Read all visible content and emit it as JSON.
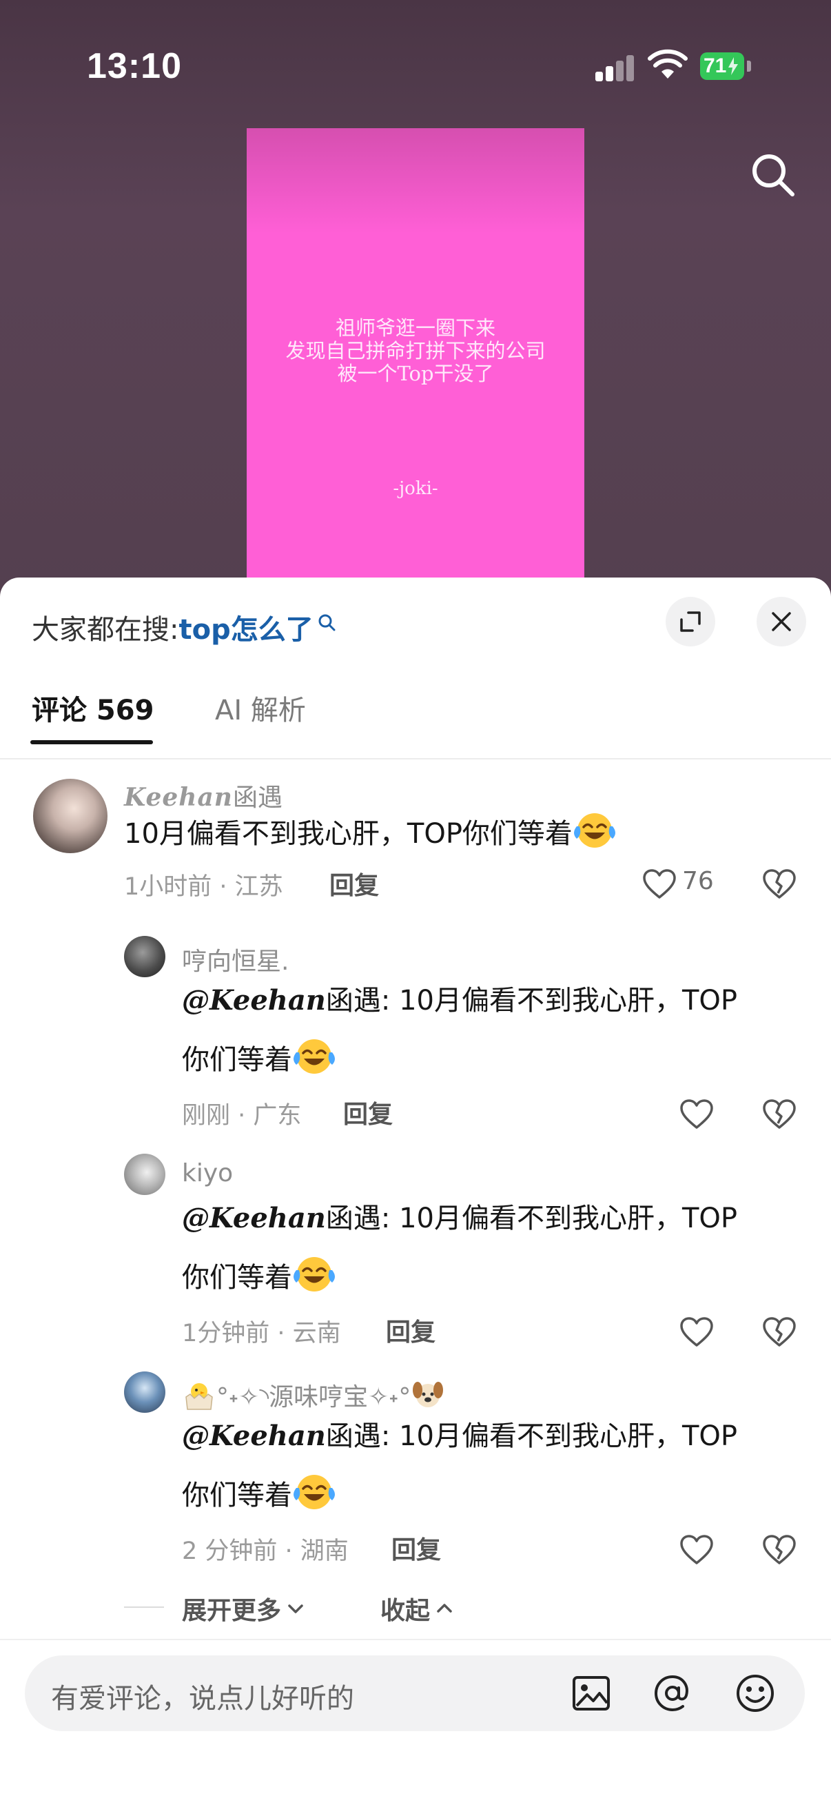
{
  "status_bar": {
    "time": "13:10",
    "battery": "71",
    "battery_color": "#34c759"
  },
  "video": {
    "lines": [
      "祖师爷逛一圈下来",
      "发现自己拼命打拼下来的公司",
      "被一个Top干没了"
    ],
    "signature": "-joki-",
    "background_color": "#ff5fd6"
  },
  "trending": {
    "prefix": "大家都在搜:",
    "keyword": "top怎么了",
    "keyword_color": "#1a5fa8"
  },
  "tabs": [
    {
      "label": "评论 569",
      "active": true
    },
    {
      "label": "AI 解析",
      "active": false
    }
  ],
  "comment": {
    "user_script": "Keehan",
    "user_cn": "函遇",
    "text": "10月偏看不到我心肝，TOP你们等着",
    "emoji": "tears-of-joy",
    "meta": "1小时前 · 江苏",
    "reply": "回复",
    "likes": "76"
  },
  "replies": [
    {
      "user": "哼向恒星.",
      "mention": "@Keehan",
      "text_line1": "函遇: 10月偏看不到我心肝，TOP",
      "text_line2": "你们等着",
      "meta": "刚刚 · 广东",
      "reply": "回复"
    },
    {
      "user": "kiyo",
      "mention": "@Keehan",
      "text_line1": "函遇: 10月偏看不到我心肝，TOP",
      "text_line2": "你们等着",
      "meta": "1分钟前 · 云南",
      "reply": "回复"
    },
    {
      "user": "°˖✧◝源味哼宝✧˖°",
      "mention": "@Keehan",
      "text_line1": "函遇: 10月偏看不到我心肝，TOP",
      "text_line2": "你们等着",
      "meta": "2 分钟前 · 湖南",
      "reply": "回复"
    }
  ],
  "thread_controls": {
    "expand_more": "展开更多",
    "collapse": "收起"
  },
  "input": {
    "placeholder": "有爱评论，说点儿好听的",
    "icons": [
      "image-icon",
      "at-icon",
      "emoji-icon"
    ]
  }
}
